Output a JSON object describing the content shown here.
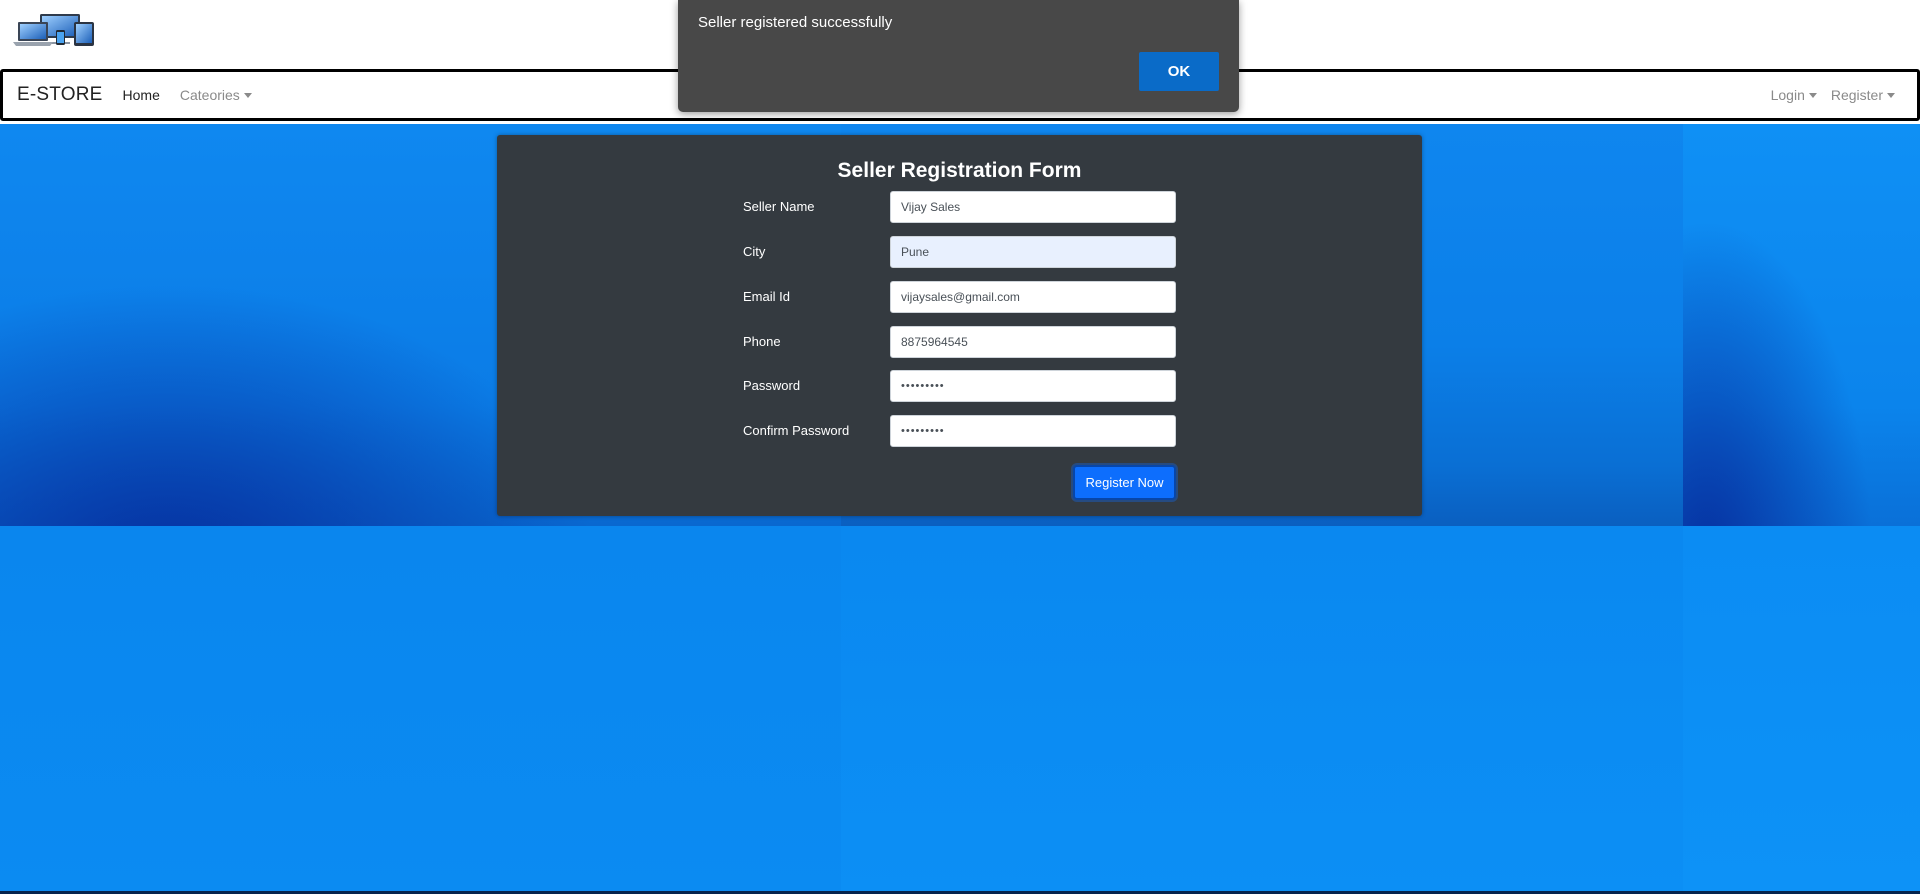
{
  "navbar": {
    "brand": "E-STORE",
    "home": "Home",
    "categories": "Cateories",
    "login": "Login",
    "register": "Register"
  },
  "form": {
    "title": "Seller Registration Form",
    "fields": {
      "seller_name": {
        "label": "Seller Name",
        "value": "Vijay Sales"
      },
      "city": {
        "label": "City",
        "value": "Pune"
      },
      "email": {
        "label": "Email Id",
        "value": "vijaysales@gmail.com"
      },
      "phone": {
        "label": "Phone",
        "value": "8875964545"
      },
      "password": {
        "label": "Password",
        "value": "•••••••••"
      },
      "confirm_password": {
        "label": "Confirm Password",
        "value": "•••••••••"
      }
    },
    "submit_label": "Register Now"
  },
  "dialog": {
    "message": "Seller registered successfully",
    "ok_label": "OK"
  },
  "icons": {
    "logo": "devices-logo-icon",
    "dropdown": "caret-down-icon"
  },
  "colors": {
    "navbar_border": "#000000",
    "card_bg": "#343a40",
    "primary": "#0d6efd",
    "dialog_bg": "#484848",
    "dialog_ok": "#0a6bc8",
    "background_blue": "#0d86ee"
  }
}
